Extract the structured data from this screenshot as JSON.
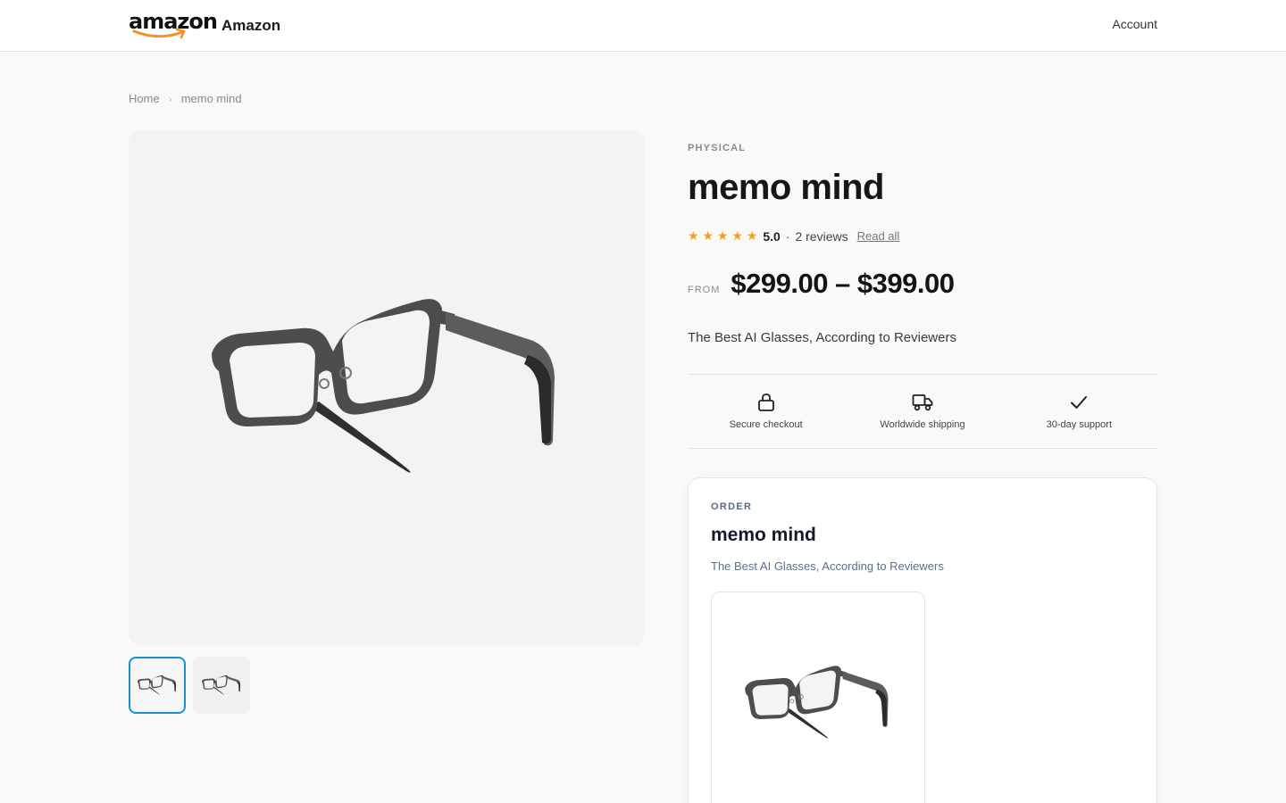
{
  "header": {
    "logo_text": "amazon",
    "brand_name": "Amazon",
    "account_label": "Account"
  },
  "breadcrumb": {
    "home": "Home",
    "separator": "›",
    "current": "memo mind"
  },
  "gallery": {
    "main_image": "glasses-product-image",
    "thumbnails": [
      "glasses-thumbnail-1",
      "glasses-thumbnail-2"
    ],
    "active_index": 0
  },
  "product": {
    "category": "PHYSICAL",
    "title": "memo mind",
    "rating": {
      "stars": "★ ★ ★ ★ ★",
      "star_count": 5,
      "score": "5.0",
      "separator": "·",
      "reviews": "2 reviews",
      "read_all": "Read all"
    },
    "price_prefix": "FROM",
    "price_range": "$299.00 – $399.00",
    "tagline": "The Best AI Glasses, According to Reviewers"
  },
  "features": [
    {
      "icon": "lock-icon",
      "label": "Secure checkout"
    },
    {
      "icon": "truck-icon",
      "label": "Worldwide shipping"
    },
    {
      "icon": "check-icon",
      "label": "30-day support"
    }
  ],
  "order": {
    "eyebrow": "ORDER",
    "title": "memo mind",
    "subtitle": "The Best AI Glasses, According to Reviewers",
    "variant_image": "glasses-variant-image"
  },
  "colors": {
    "accent_star": "#f0a21b",
    "thumb_active_border": "#1a8fd6",
    "order_eyebrow": "#5b6b80",
    "order_subtitle": "#5d6f8c"
  }
}
